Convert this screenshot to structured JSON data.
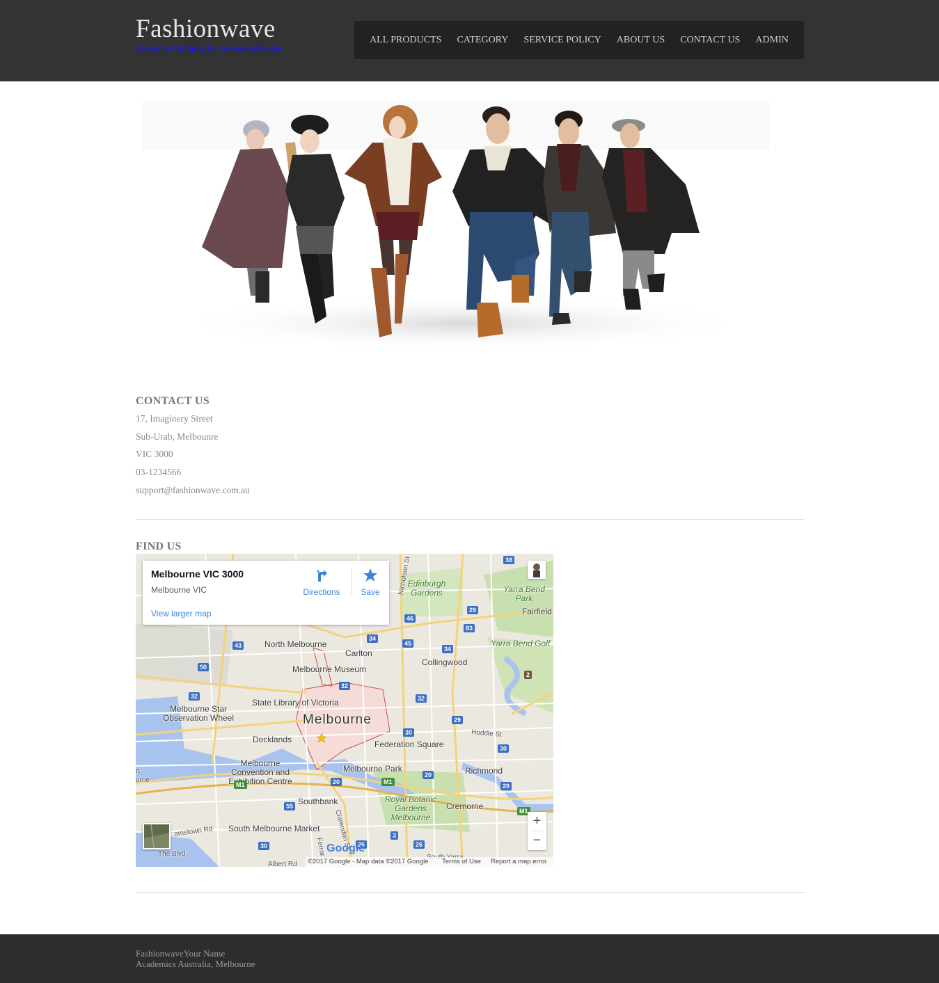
{
  "header": {
    "site_title": "Fashionwave",
    "tagline": "Awesome Clothing for Awesome People",
    "colors": {
      "background": "#333333",
      "nav_background": "#222222",
      "tagline": "#1414ff"
    }
  },
  "nav": {
    "items": [
      {
        "label": "ALL PRODUCTS"
      },
      {
        "label": "CATEGORY"
      },
      {
        "label": "SERVICE POLICY"
      },
      {
        "label": "ABOUT US"
      },
      {
        "label": "CONTACT US"
      },
      {
        "label": "ADMIN"
      }
    ]
  },
  "hero": {
    "alt": "group of six models in winter coats"
  },
  "contact": {
    "heading": "CONTACT US",
    "lines": [
      "17, Imaginery Street",
      "Sub-Urab, Melbounre",
      "VIC 3000",
      "03-1234566",
      "support@fashionwave.com.au"
    ]
  },
  "find_us": {
    "heading": "FIND US",
    "map": {
      "card_title": "Melbourne VIC 3000",
      "card_subtitle": "Melbourne VIC",
      "directions_label": "Directions",
      "save_label": "Save",
      "view_larger_label": "View larger map",
      "zoom_in": "+",
      "zoom_out": "−",
      "copyright": "©2017 Google - Map data ©2017 Google",
      "terms": "Terms of Use",
      "report": "Report a map error",
      "google_logo": "Google",
      "places": {
        "north_melbourne": "North Melbourne",
        "carlton": "Carlton",
        "collingwood": "Collingwood",
        "fairfield": "Fairfield",
        "melbourne_museum": "Melbourne Museum",
        "state_library": "State Library of Victoria",
        "melbourne": "Melbourne",
        "melbourne_star": "Melbourne Star Observation Wheel",
        "docklands": "Docklands",
        "federation_square": "Federation Square",
        "melbourne_convention": "Melbourne Convention and Exhibition Centre",
        "melbourne_park": "Melbourne Park",
        "richmond": "Richmond",
        "southbank": "Southbank",
        "south_melbourne_market": "South Melbourne Market",
        "cremorne": "Cremorne",
        "edinburgh_gardens": "Edinburgh Gardens",
        "yarra_bend_park": "Yarra Bend Park",
        "yarra_bend_golf": "Yarra Bend Golf",
        "royal_botanic": "Royal Botanic Gardens Melbourne",
        "hoddle_st": "Hoddle St",
        "nicholson_st": "Nicholson St",
        "clarendon_st": "Clarendon St",
        "ferrars": "Ferrar",
        "plummer_rd": "amstown Rd",
        "the_blvd": "The Blvd",
        "south_yarra": "South Yarra",
        "port_edge": "rt",
        "port_edge2": "urne",
        "albert": "Albert Rd"
      },
      "shields": [
        "38",
        "29",
        "46",
        "83",
        "34",
        "45",
        "34",
        "43",
        "50",
        "32",
        "32",
        "32",
        "29",
        "30",
        "30",
        "20",
        "20",
        "20",
        "M1",
        "M1",
        "M1",
        "55",
        "3",
        "26",
        "30",
        "26",
        "2"
      ]
    }
  },
  "footer": {
    "line1": "FashionwaveYour Name",
    "line2": "Academics Australia, Melbourne"
  }
}
